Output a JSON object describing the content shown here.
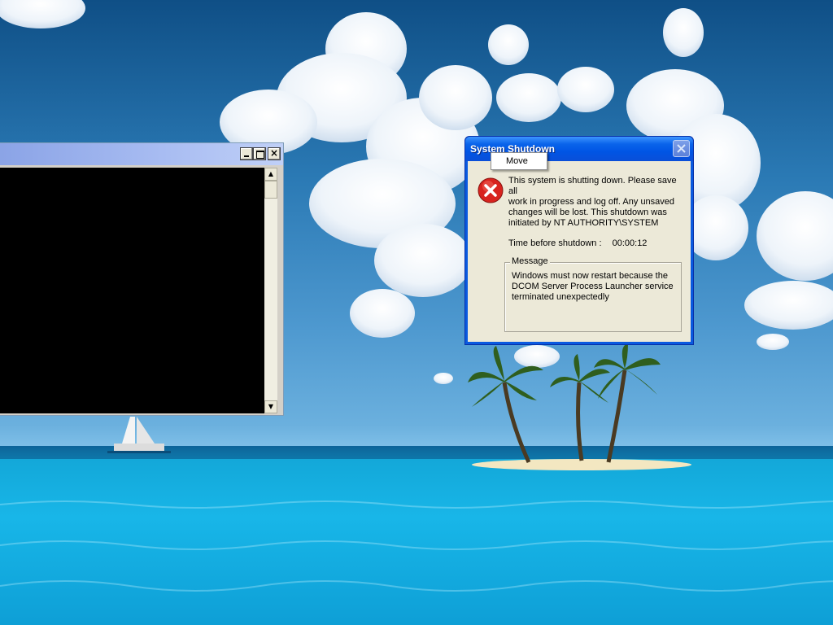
{
  "desktop": {
    "wallpaper": "tropical-island-wallpaper"
  },
  "console_window": {
    "title": "",
    "controls": {
      "minimize_icon": "minimize-icon",
      "maximize_icon": "maximize-icon",
      "close_glyph": "×"
    },
    "scroll_up_glyph": "▲",
    "scroll_down_glyph": "▼"
  },
  "shutdown_dialog": {
    "title": "System Shutdown",
    "close_icon": "close-icon",
    "icon": "error-icon",
    "message_lines": [
      "This system is shutting down. Please save all",
      "work in progress and log off. Any unsaved",
      "changes will be lost. This shutdown was",
      "initiated by NT AUTHORITY\\SYSTEM"
    ],
    "time_label": "Time before shutdown :",
    "time_value": "00:00:12",
    "message_group_label": "Message",
    "message_group_lines": [
      "Windows must now restart because the",
      "DCOM Server Process Launcher service",
      "terminated unexpectedly"
    ]
  },
  "context_menu": {
    "items": [
      {
        "label": "Move"
      }
    ]
  },
  "colors": {
    "xp_title_blue": "#0055e5",
    "dialog_face": "#ece9d8",
    "console_bg": "#000000",
    "error_red": "#d8231e"
  }
}
